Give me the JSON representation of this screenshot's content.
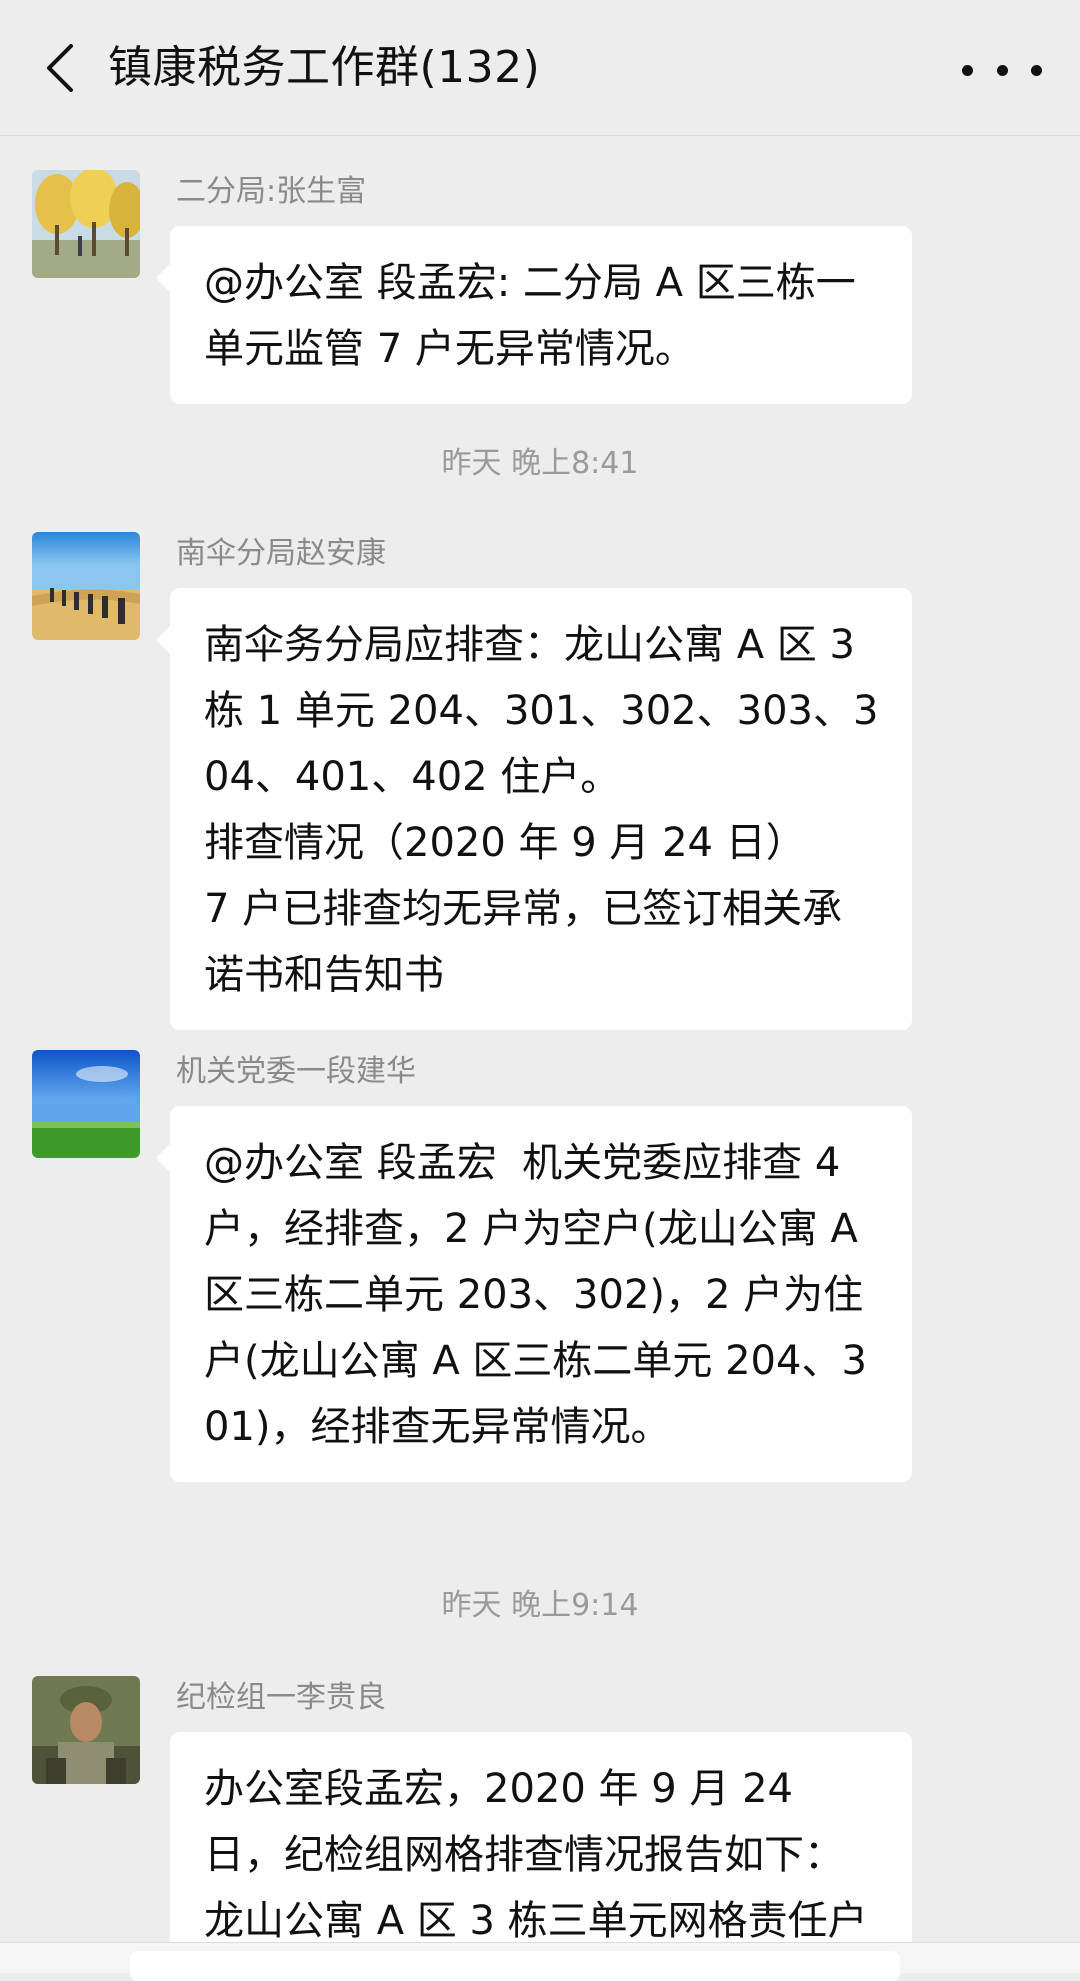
{
  "header": {
    "title": "镇康税务工作群(132)",
    "back_icon": "chevron-left-icon",
    "more_icon": "more-horizontal-icon"
  },
  "messages": [
    {
      "sender": "二分局:张生富",
      "text": "@办公室 段孟宏: 二分局 A 区三栋一单元监管 7 户无异常情况。"
    },
    {
      "sender": "南伞分局赵安康",
      "text": "南伞务分局应排查：龙山公寓 A 区 3 栋 1 单元 204、301、302、303、304、401、402 住户。\n排查情况（2020 年 9 月 24 日）\n7 户已排查均无异常，已签订相关承诺书和告知书"
    },
    {
      "sender": "机关党委一段建华",
      "text": "@办公室 段孟宏  机关党委应排查 4 户，经排查，2 户为空户(龙山公寓 A 区三栋二单元 203、302)，2 户为住户(龙山公寓 A 区三栋二单元 204、301)，经排查无异常情况。"
    },
    {
      "sender": "纪检组一李贵良",
      "text": "办公室段孟宏，2020 年 9 月 24 日，纪检组网格排查情况报告如下：龙山公寓 A 区 3 栋三单元网格责任户"
    }
  ],
  "timestamps": [
    "昨天 晚上8:41",
    "昨天 晚上9:14"
  ]
}
